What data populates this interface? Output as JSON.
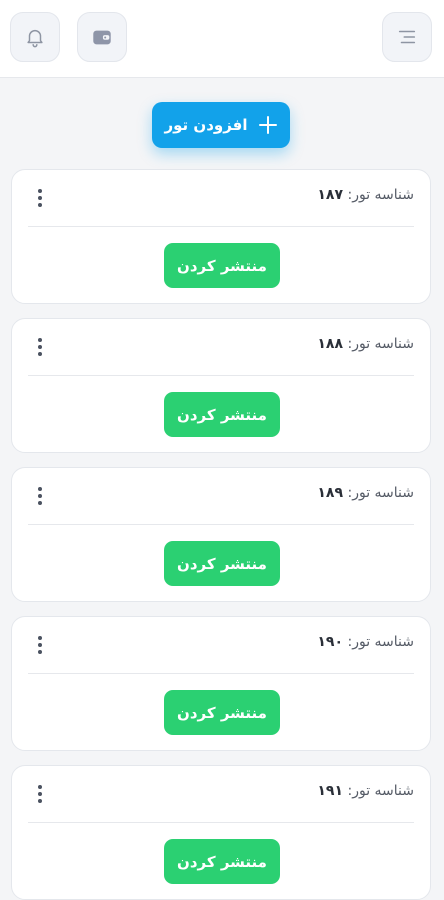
{
  "header": {
    "notifications_icon": "bell-icon",
    "wallet_icon": "wallet-icon",
    "menu_icon": "menu-icon"
  },
  "add_tour": {
    "label": "افزودن تور",
    "icon": "plus-icon"
  },
  "tours": [
    {
      "id_label": "شناسه تور:",
      "id": "۱۸۷",
      "publish_label": "منتشر کردن"
    },
    {
      "id_label": "شناسه تور:",
      "id": "۱۸۸",
      "publish_label": "منتشر کردن"
    },
    {
      "id_label": "شناسه تور:",
      "id": "۱۸۹",
      "publish_label": "منتشر کردن"
    },
    {
      "id_label": "شناسه تور:",
      "id": "۱۹۰",
      "publish_label": "منتشر کردن"
    },
    {
      "id_label": "شناسه تور:",
      "id": "۱۹۱",
      "publish_label": "منتشر کردن"
    }
  ],
  "colors": {
    "primary": "#12a2ea",
    "success": "#2bd072",
    "background": "#f4f5f7"
  }
}
